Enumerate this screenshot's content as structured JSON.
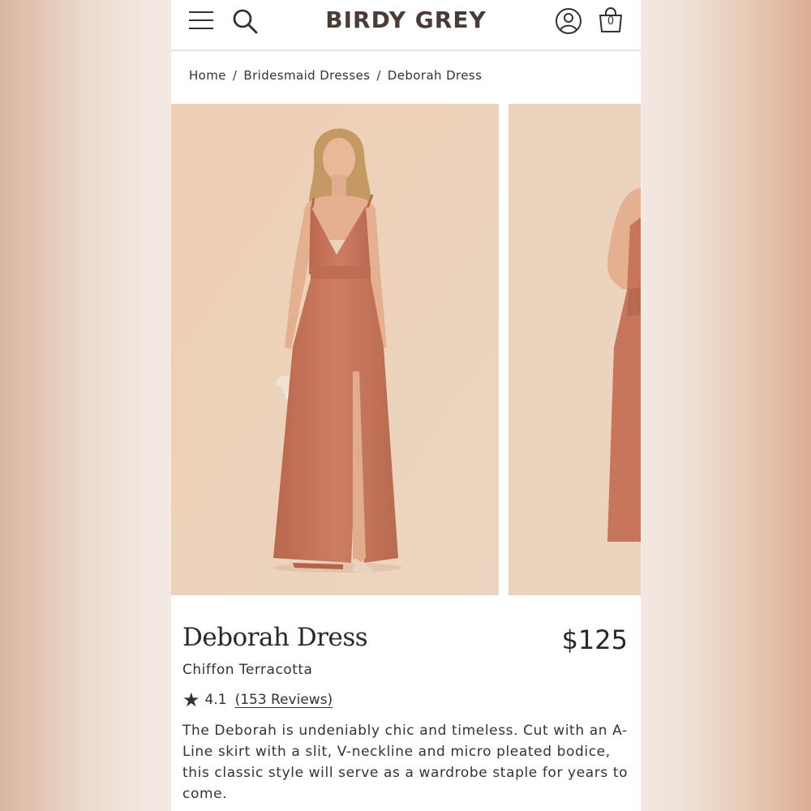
{
  "header": {
    "brand": "BIRDY GREY",
    "cart_count": "0",
    "icons": [
      "menu-icon",
      "search-icon",
      "account-icon",
      "cart-icon"
    ]
  },
  "breadcrumb": [
    {
      "label": "Home"
    },
    {
      "label": "Bridesmaid Dresses"
    },
    {
      "label": "Deborah Dress"
    }
  ],
  "gallery": {
    "images": [
      "model-front-view",
      "model-side-view"
    ],
    "expand_icon": "expand-icon"
  },
  "product": {
    "title": "Deborah Dress",
    "price": "$125",
    "color": "Chiffon Terracotta",
    "rating": "4.1",
    "reviews": "(153 Reviews)",
    "description": "The Deborah is undeniably chic and timeless. Cut with an A-Line skirt with a slit, V-neckline and micro pleated bodice, this classic style will serve as a wardrobe staple for years to come."
  },
  "colors": {
    "dress": "#c7765c",
    "backdrop": "#ecd1b8",
    "text": "#2f2724"
  }
}
